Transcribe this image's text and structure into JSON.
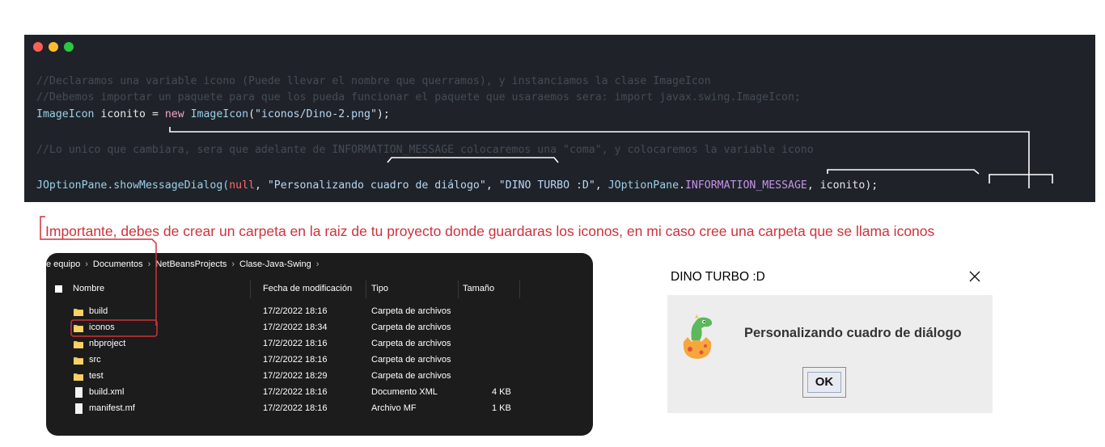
{
  "code_window": {
    "line1": "//Declaramos una variable icono (Puede llevar el nombre que querramos), y instanciamos la clase ImageIcon",
    "line2": "//Debemos importar un paquete para que los pueda funcionar el paquete que usaraemos sera: import javax.swing.ImageIcon;",
    "line3": {
      "type": "ImageIcon",
      "var": "iconito",
      "op": " = ",
      "kw": "new",
      "cls": "ImageIcon",
      "open": "(",
      "str": "\"iconos/Dino-2.png\"",
      "close": ");"
    },
    "line4": "//Lo unico que cambiara, sera que adelante de INFORMATION_MESSAGE colocaremos una \"coma\", y colocaremos la variable icono",
    "line5": {
      "cls": "JOptionPane",
      "method": ".showMessageDialog(",
      "null_kw": "null",
      "sep1": ", ",
      "str1": "\"Personalizando cuadro de diálogo\"",
      "sep2": ", ",
      "str2": "\"DINO TURBO :D\"",
      "sep3": ", ",
      "cls2": "JOptionPane",
      "dot": ".",
      "const": "INFORMATION_MESSAGE",
      "sep4": ", ",
      "var": "iconito",
      "end": ");"
    }
  },
  "note": "Importante, debes de crear un carpeta en la raiz de tu proyecto donde guardaras los iconos, en mi caso cree una carpeta que se llama iconos",
  "explorer": {
    "breadcrumb": [
      "e equipo",
      "Documentos",
      "NetBeansProjects",
      "Clase-Java-Swing"
    ],
    "breadcrumb_sep": "›",
    "headers": {
      "name": "Nombre",
      "date": "Fecha de modificación",
      "type": "Tipo",
      "size": "Tamaño"
    },
    "rows": [
      {
        "name": "build",
        "date": "17/2/2022 18:16",
        "type": "Carpeta de archivos",
        "size": "",
        "icon": "folder-icon"
      },
      {
        "name": "iconos",
        "date": "17/2/2022 18:34",
        "type": "Carpeta de archivos",
        "size": "",
        "icon": "folder-icon"
      },
      {
        "name": "nbproject",
        "date": "17/2/2022 18:16",
        "type": "Carpeta de archivos",
        "size": "",
        "icon": "folder-icon"
      },
      {
        "name": "src",
        "date": "17/2/2022 18:16",
        "type": "Carpeta de archivos",
        "size": "",
        "icon": "folder-icon"
      },
      {
        "name": "test",
        "date": "17/2/2022 18:29",
        "type": "Carpeta de archivos",
        "size": "",
        "icon": "folder-icon"
      },
      {
        "name": "build.xml",
        "date": "17/2/2022 18:16",
        "type": "Documento XML",
        "size": "4 KB",
        "icon": "file-icon"
      },
      {
        "name": "manifest.mf",
        "date": "17/2/2022 18:16",
        "type": "Archivo MF",
        "size": "1 KB",
        "icon": "file-icon"
      }
    ]
  },
  "dialog": {
    "title": "DINO TURBO :D",
    "message": "Personalizando cuadro de diálogo",
    "ok_label": "OK",
    "icon": "dino-egg-icon"
  },
  "colors": {
    "accent_red": "#d0313b",
    "code_bg": "#1f2329",
    "explorer_bg": "#1c1c1c",
    "folder": "#f2c14e"
  }
}
